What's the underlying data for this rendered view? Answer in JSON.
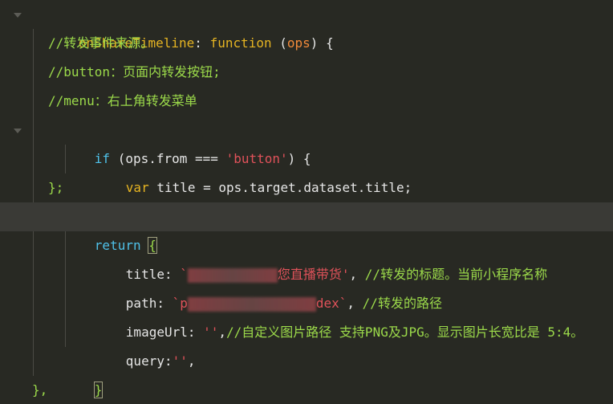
{
  "lines": {
    "l1": {
      "name": "onShareTimeline",
      "colon": ": ",
      "func": "function",
      "open": " (",
      "param": "ops",
      "close": ") {"
    },
    "l2": {
      "comment": "//转发事件来源。"
    },
    "l3": {
      "comment": "//button：页面内转发按钮;"
    },
    "l4": {
      "comment": "//menu：右上角转发菜单"
    },
    "l5": {
      "kw": "if",
      "open": " (ops.from === ",
      "str": "'button'",
      "close": ") {"
    },
    "l6": {
      "kw": "var",
      "rest": " title = ops.target.dataset.title;"
    },
    "l7": {
      "text": "};"
    },
    "l8": {
      "kw": "return",
      "space": " ",
      "brace": "{"
    },
    "l9": {
      "key": "title: ",
      "str_start": "`",
      "str_visible": "您直播带货",
      "str_end": "'",
      "comma": ", ",
      "comment": "//转发的标题。当前小程序名称"
    },
    "l10": {
      "key": "path: ",
      "str_start": "`p",
      "str_visible": "dex",
      "str_end": "`",
      "comma": ", ",
      "comment": "//转发的路径"
    },
    "l11": {
      "key": "imageUrl: ",
      "str": "''",
      "comma": ",",
      "comment": "//自定义图片路径 支持PNG及JPG。显示图片长宽比是 5:4。"
    },
    "l12": {
      "key": "query:",
      "str": "''",
      "comma": ","
    },
    "l13": {
      "brace": "}"
    },
    "l14": {
      "text": "},"
    }
  }
}
